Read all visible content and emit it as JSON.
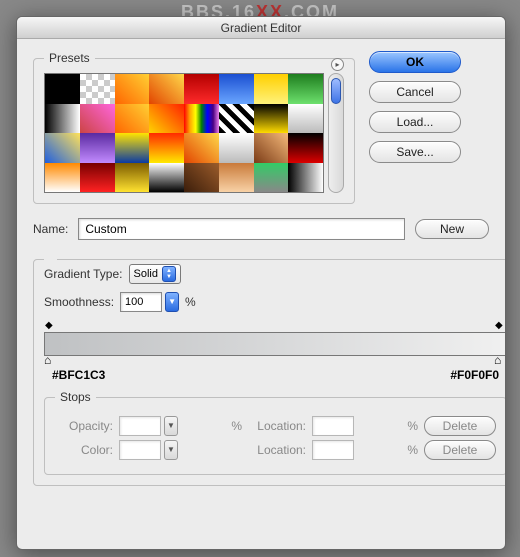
{
  "watermark_pre": "BBS.16",
  "watermark_xx": "XX",
  "watermark_post": ".COM",
  "window": {
    "title": "Gradient Editor"
  },
  "buttons": {
    "ok": "OK",
    "cancel": "Cancel",
    "load": "Load...",
    "save": "Save...",
    "new": "New",
    "delete": "Delete"
  },
  "presets": {
    "legend": "Presets"
  },
  "name": {
    "label": "Name:",
    "value": "Custom"
  },
  "gradient": {
    "type_label": "Gradient Type:",
    "type_value": "Solid",
    "smoothness_label": "Smoothness:",
    "smoothness_value": "100",
    "percent": "%",
    "left_hex": "#BFC1C3",
    "right_hex": "#F0F0F0"
  },
  "stops": {
    "legend": "Stops",
    "opacity_label": "Opacity:",
    "color_label": "Color:",
    "location_label": "Location:",
    "opacity_value": "",
    "opacity_location": "",
    "color_location": ""
  }
}
